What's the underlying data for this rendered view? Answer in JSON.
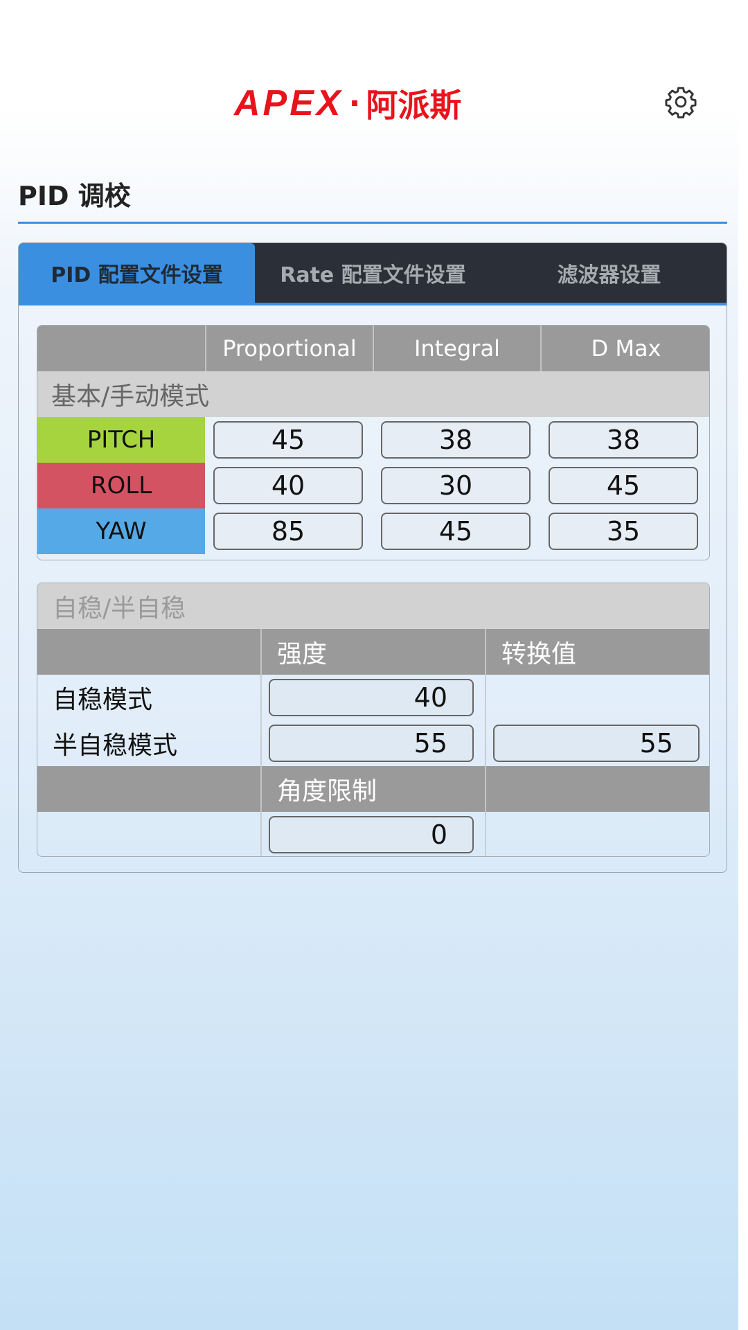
{
  "header": {
    "logo_en": "APEX",
    "logo_dot": "·",
    "logo_cn": "阿派斯",
    "settings_icon": "gear-icon",
    "brand_color": "#e8131b"
  },
  "page": {
    "title": "PID 调校"
  },
  "tabs": [
    {
      "label": "PID 配置文件设置",
      "active": true
    },
    {
      "label": "Rate 配置文件设置",
      "active": false
    },
    {
      "label": "滤波器设置",
      "active": false
    }
  ],
  "pid_table": {
    "columns": [
      "Proportional",
      "Integral",
      "D Max"
    ],
    "group_label": "基本/手动模式",
    "rows": [
      {
        "axis": "PITCH",
        "color": "#a6d43f",
        "values": [
          "45",
          "38",
          "38"
        ]
      },
      {
        "axis": "ROLL",
        "color": "#d45363",
        "values": [
          "40",
          "30",
          "45"
        ]
      },
      {
        "axis": "YAW",
        "color": "#55a9e6",
        "values": [
          "85",
          "45",
          "35"
        ]
      }
    ]
  },
  "level_table": {
    "title": "自稳/半自稳",
    "col_strength": "强度",
    "col_transition": "转换值",
    "row_angle_mode": {
      "label": "自稳模式",
      "strength": "40"
    },
    "row_horizon_mode": {
      "label": "半自稳模式",
      "strength": "55",
      "transition": "55"
    },
    "col_angle_limit": "角度限制",
    "angle_limit": "0"
  }
}
